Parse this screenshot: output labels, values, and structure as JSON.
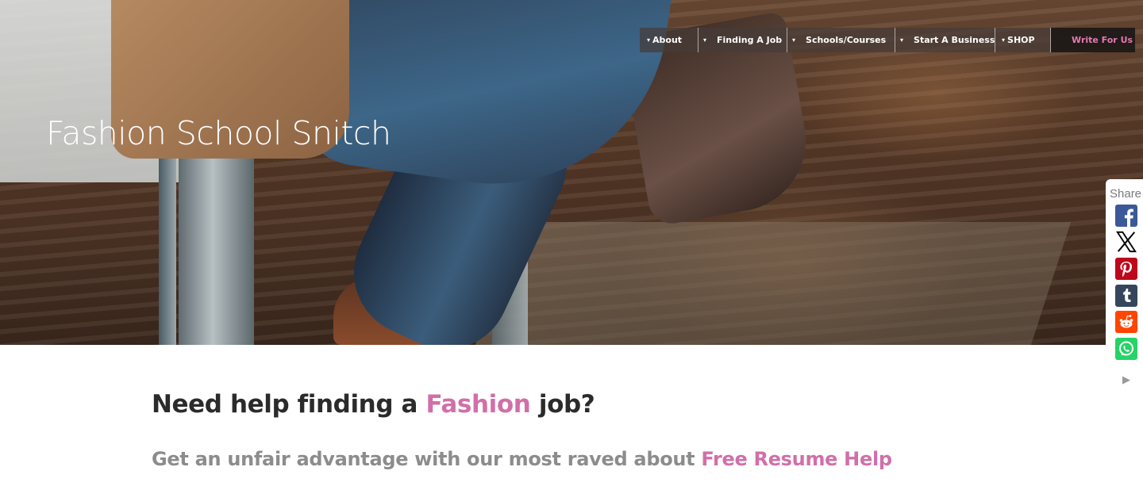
{
  "site": {
    "title": "Fashion School Snitch"
  },
  "nav": {
    "caret": "▾",
    "items": [
      {
        "label": "About"
      },
      {
        "label": "Finding A Job"
      },
      {
        "label": "Schools/Courses"
      },
      {
        "label": "Start A Business"
      },
      {
        "label": "SHOP"
      },
      {
        "label": "Write For Us"
      }
    ],
    "accent_color": "#e07ab4"
  },
  "main": {
    "headline_pre": "Need help finding a ",
    "headline_accent": "Fashion",
    "headline_post": " job?",
    "subline_pre": "Get an unfair advantage with our most raved about ",
    "subline_link": "Free Resume Help",
    "accent_color": "#d16fa9"
  },
  "share": {
    "label": "Share",
    "buttons": [
      {
        "name": "facebook",
        "icon": "facebook-icon",
        "color": "#3b5998"
      },
      {
        "name": "x",
        "icon": "x-icon",
        "color": "#000000"
      },
      {
        "name": "pinterest",
        "icon": "pinterest-icon",
        "color": "#bd081c"
      },
      {
        "name": "tumblr",
        "icon": "tumblr-icon",
        "color": "#35465c"
      },
      {
        "name": "reddit",
        "icon": "reddit-icon",
        "color": "#ff4500"
      },
      {
        "name": "whatsapp",
        "icon": "whatsapp-icon",
        "color": "#25d366"
      }
    ],
    "collapse_arrow": "▶"
  }
}
